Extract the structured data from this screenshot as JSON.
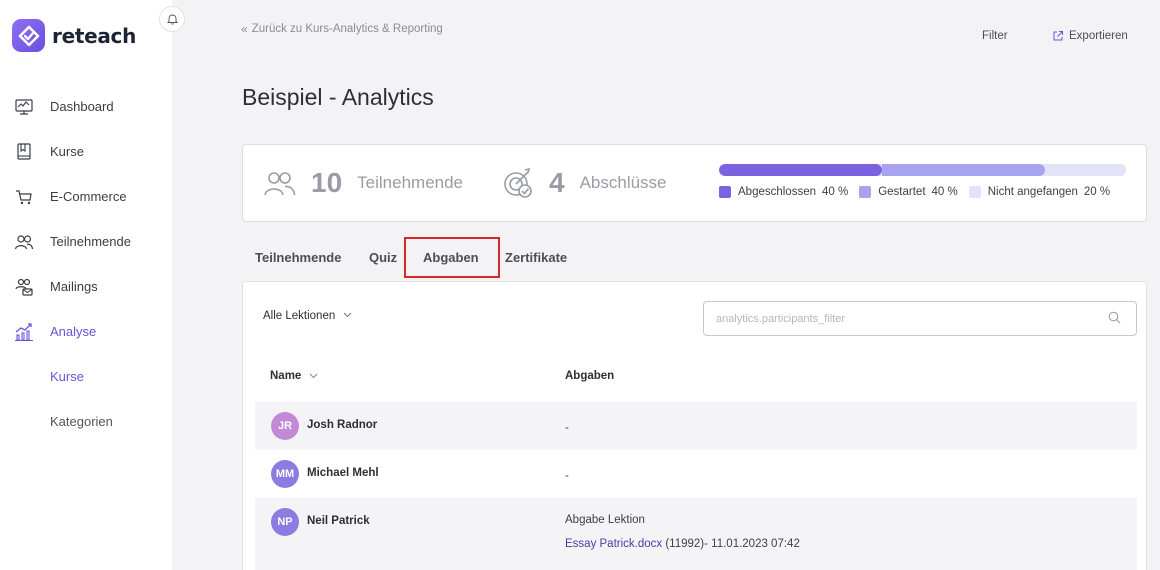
{
  "app": {
    "logo_text": "reteach"
  },
  "sidebar": {
    "items": [
      {
        "label": "Dashboard",
        "icon": "dashboard-icon"
      },
      {
        "label": "Kurse",
        "icon": "book-icon"
      },
      {
        "label": "E-Commerce",
        "icon": "cart-icon"
      },
      {
        "label": "Teilnehmende",
        "icon": "users-icon"
      },
      {
        "label": "Mailings",
        "icon": "mailing-icon"
      },
      {
        "label": "Analyse",
        "icon": "analytics-icon",
        "active": true
      }
    ],
    "subitems": [
      {
        "label": "Kurse",
        "active": true
      },
      {
        "label": "Kategorien"
      }
    ]
  },
  "header": {
    "back_link": "Zurück zu Kurs-Analytics & Reporting",
    "filter_label": "Filter",
    "export_label": "Exportieren",
    "title": "Beispiel - Analytics"
  },
  "stats": {
    "participants_count": "10",
    "participants_label": "Teilnehmende",
    "completions_count": "4",
    "completions_label": "Abschlüsse",
    "progress": [
      {
        "label": "Abgeschlossen",
        "percent_label": "40 %",
        "value": 0.4,
        "color": "#7a62e0"
      },
      {
        "label": "Gestartet",
        "percent_label": "40 %",
        "value": 0.4,
        "color": "#a7a3ef"
      },
      {
        "label": "Nicht angefangen",
        "percent_label": "20 %",
        "value": 0.2,
        "color": "#e3e3f7"
      }
    ]
  },
  "tabs": [
    {
      "label": "Teilnehmende"
    },
    {
      "label": "Quiz"
    },
    {
      "label": "Abgaben",
      "active": true
    },
    {
      "label": "Zertifikate"
    }
  ],
  "content": {
    "lesson_select": "Alle Lektionen",
    "search_placeholder": "analytics.participants_filter",
    "col_name": "Name",
    "col_submissions": "Abgaben",
    "rows": [
      {
        "initials": "JR",
        "name": "Josh Radnor",
        "avatar_color": "#c28ad6",
        "submission": "-"
      },
      {
        "initials": "MM",
        "name": "Michael Mehl",
        "avatar_color": "#8c7be0",
        "submission": "-"
      },
      {
        "initials": "NP",
        "name": "Neil Patrick",
        "avatar_color": "#8c7be0",
        "submission_title": "Abgabe Lektion",
        "file_name": "Essay Patrick.docx",
        "file_meta": " (11992)- 11.01.2023 07:42"
      }
    ]
  }
}
